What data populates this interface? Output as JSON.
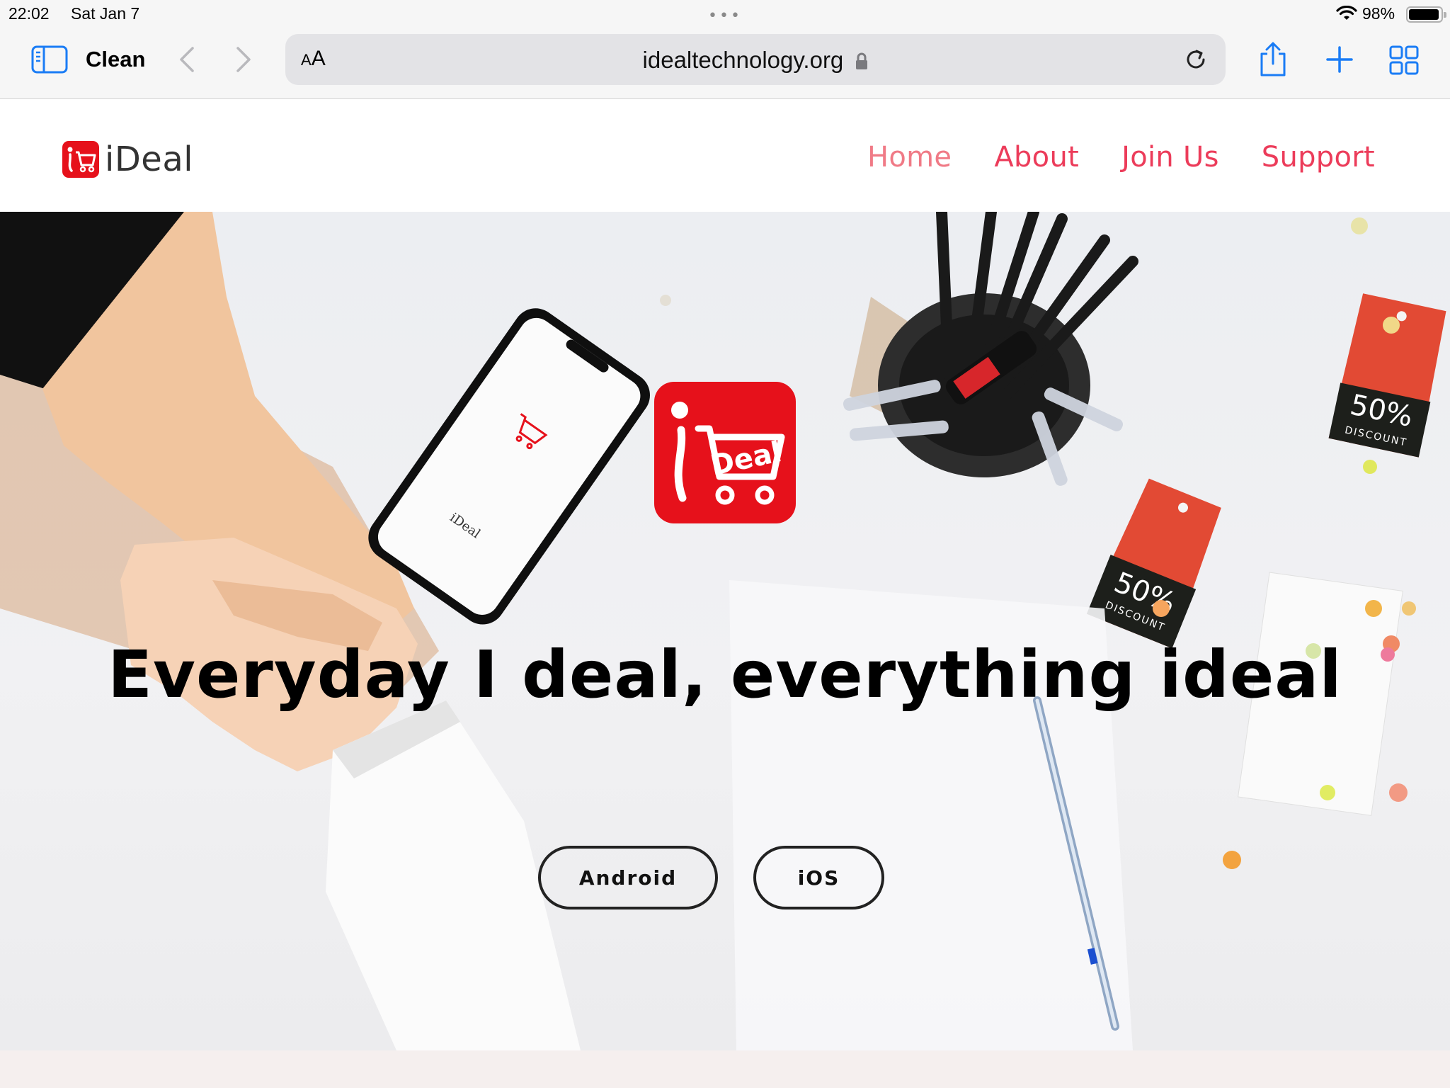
{
  "status_bar": {
    "time": "22:02",
    "date": "Sat Jan 7",
    "battery_percent_text": "98%",
    "battery_level": 0.98
  },
  "browser": {
    "tab_group_title": "Clean",
    "aa_label_small": "A",
    "aa_label_big": "A",
    "url": "idealtechnology.org",
    "accent_color": "#1a7cf5"
  },
  "site": {
    "brand_name": "iDeal",
    "brand_color": "#e6111b",
    "nav": {
      "home": "Home",
      "about": "About",
      "join": "Join Us",
      "support": "Support"
    }
  },
  "hero": {
    "title": "Everyday I deal, everything ideal",
    "buttons": {
      "android": "Android",
      "ios": "iOS"
    },
    "logo_text": "Deal",
    "tag_text_1": "50%",
    "tag_text_2": "DISCOUNT"
  }
}
